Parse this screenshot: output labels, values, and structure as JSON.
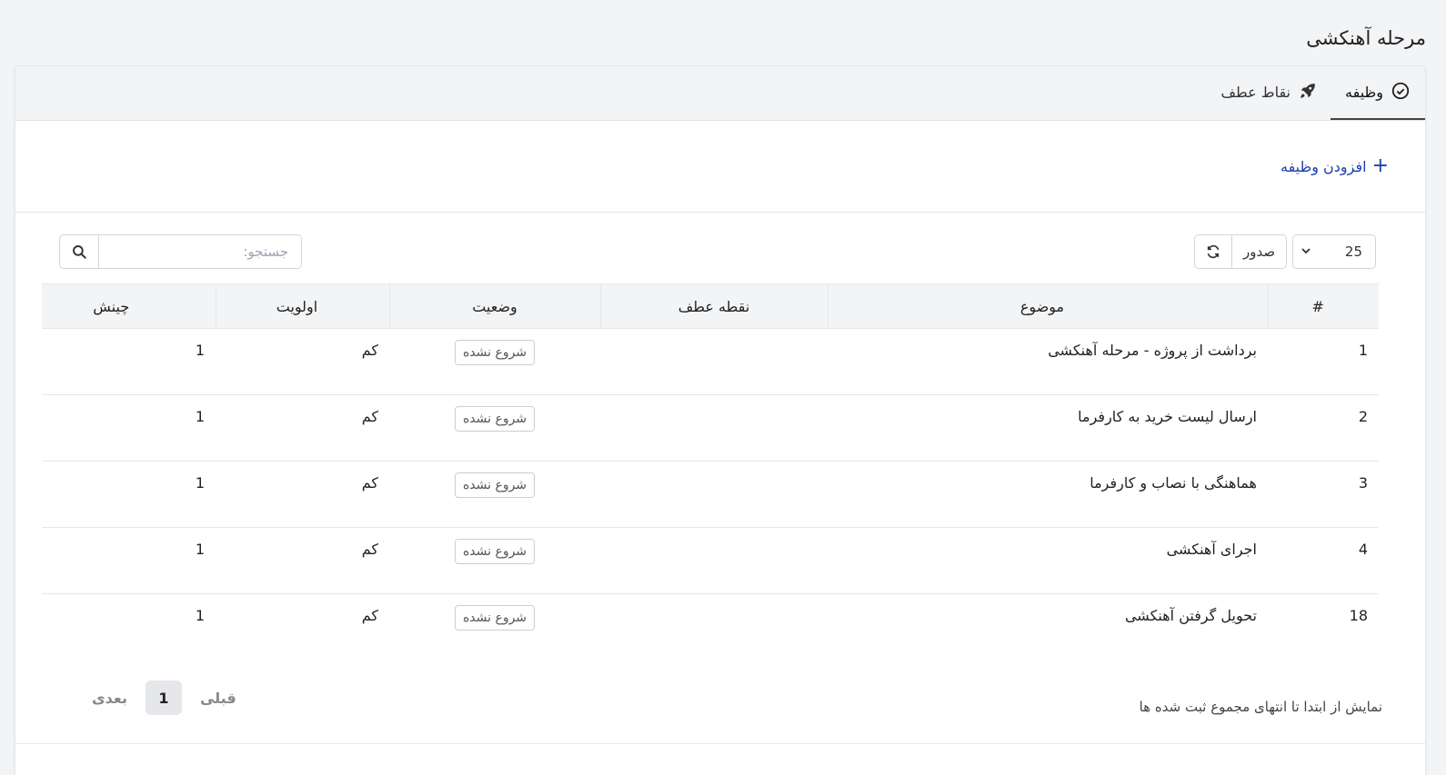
{
  "page": {
    "title": "مرحله آهنکشی"
  },
  "tabs": [
    {
      "label": "وظیفه",
      "icon": "check-circle-icon",
      "active": true
    },
    {
      "label": "نقاط عطف",
      "icon": "rocket-icon",
      "active": false
    }
  ],
  "actions": {
    "add_task_label": "افزودن وظیفه"
  },
  "toolbar": {
    "page_length": "25",
    "export_label": "صدور",
    "search_placeholder": "جستجو:"
  },
  "table": {
    "headers": {
      "num": "#",
      "subject": "موضوع",
      "milestone": "نقطه عطف",
      "status": "وضعیت",
      "priority": "اولویت",
      "sort": "چینش"
    },
    "rows": [
      {
        "num": "1",
        "subject": "برداشت از پروژه - مرحله آهنکشی",
        "milestone": "",
        "status": "شروع نشده",
        "priority": "کم",
        "sort": "1"
      },
      {
        "num": "2",
        "subject": "ارسال لیست خرید به کارفرما",
        "milestone": "",
        "status": "شروع نشده",
        "priority": "کم",
        "sort": "1"
      },
      {
        "num": "3",
        "subject": "هماهنگی با نصاب و کارفرما",
        "milestone": "",
        "status": "شروع نشده",
        "priority": "کم",
        "sort": "1"
      },
      {
        "num": "4",
        "subject": "اجرای آهنکشی",
        "milestone": "",
        "status": "شروع نشده",
        "priority": "کم",
        "sort": "1"
      },
      {
        "num": "18",
        "subject": "تحویل گرفتن آهنکشی",
        "milestone": "",
        "status": "شروع نشده",
        "priority": "کم",
        "sort": "1"
      }
    ]
  },
  "footer": {
    "info": "نمایش از ابتدا تا انتهای مجموع ثبت شده ها",
    "prev_label": "قبلی",
    "current_page": "1",
    "next_label": "بعدی"
  }
}
